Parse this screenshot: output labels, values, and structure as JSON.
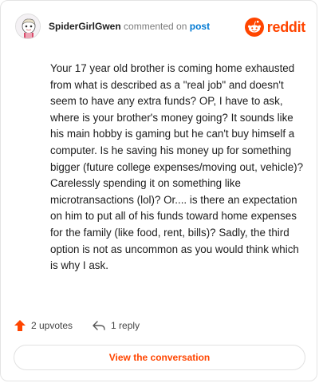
{
  "header": {
    "username": "SpiderGirlGwen",
    "action_text": "commented on",
    "post_link": "post",
    "brand_name": "reddit"
  },
  "comment": {
    "body": "Your 17 year old brother is coming home exhausted from what is described as a \"real job\" and doesn't seem to have any extra funds? OP, I have to ask, where is your brother's money going? It sounds like his main hobby is gaming but he can't buy himself a computer. Is he saving his money up for something bigger (future college expenses/moving out, vehicle)? Carelessly spending it on something like microtransactions (lol)? Or.... is there an expectation on him to put all of his funds toward home expenses for the family (like food, rent, bills)? Sadly, the third option is not as uncommon as you would think which is why I ask."
  },
  "actions": {
    "upvotes": "2 upvotes",
    "replies": "1 reply"
  },
  "cta": {
    "label": "View the conversation"
  },
  "colors": {
    "brand": "#ff4500",
    "link": "#0079d3",
    "text": "#1c1c1c",
    "muted": "#7c7c7c"
  },
  "icons": {
    "avatar": "user-avatar",
    "brand": "reddit-logo-icon",
    "upvote": "upvote-arrow-icon",
    "reply": "reply-arrow-icon"
  }
}
